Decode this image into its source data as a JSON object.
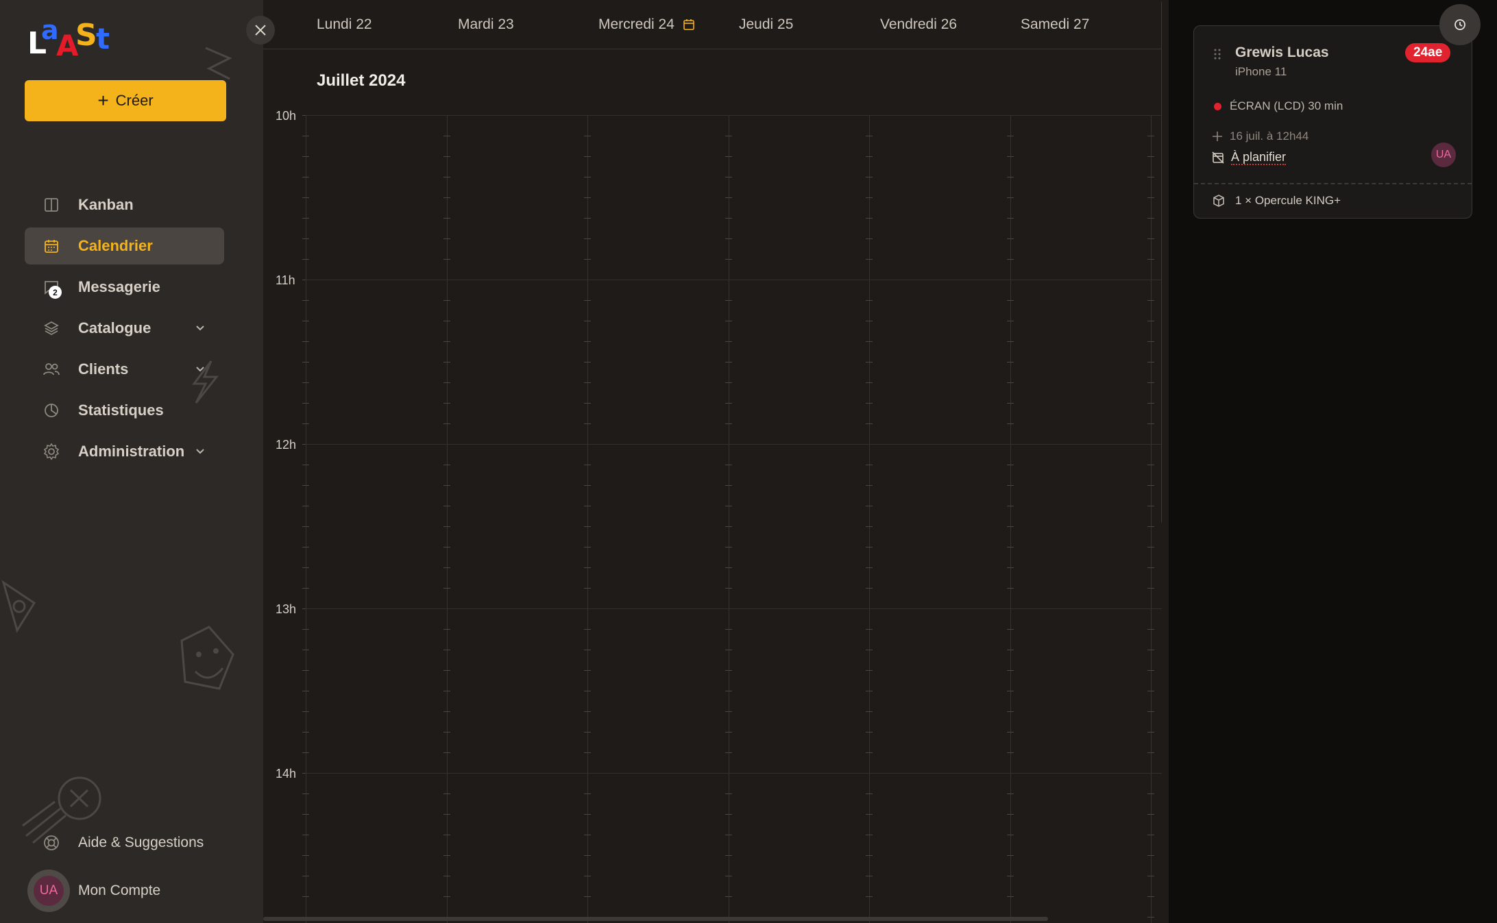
{
  "app": {
    "logo_text": "LaASt",
    "colors": {
      "accent": "#f4b31b",
      "badge_red": "#e1232f",
      "avatar_pink": "#ef6aa0"
    }
  },
  "sidebar": {
    "create_label": "Créer",
    "items": [
      {
        "label": "Kanban",
        "icon": "kanban-icon",
        "active": false,
        "expandable": false
      },
      {
        "label": "Calendrier",
        "icon": "calendar-icon",
        "active": true,
        "expandable": false
      },
      {
        "label": "Messagerie",
        "icon": "message-icon",
        "active": false,
        "expandable": false,
        "badge": "2"
      },
      {
        "label": "Catalogue",
        "icon": "layers-icon",
        "active": false,
        "expandable": true
      },
      {
        "label": "Clients",
        "icon": "users-icon",
        "active": false,
        "expandable": true
      },
      {
        "label": "Statistiques",
        "icon": "pie-chart-icon",
        "active": false,
        "expandable": false
      },
      {
        "label": "Administration",
        "icon": "gear-icon",
        "active": false,
        "expandable": true
      }
    ],
    "help_label": "Aide & Suggestions",
    "account_label": "Mon Compte",
    "account_initials": "UA"
  },
  "calendar": {
    "days": [
      "Lundi 22",
      "Mardi 23",
      "Mercredi 24",
      "Jeudi 25",
      "Vendredi 26",
      "Samedi 27"
    ],
    "today_index": 2,
    "month_title": "Juillet 2024",
    "hours": [
      "10h",
      "11h",
      "12h",
      "13h",
      "14h"
    ]
  },
  "card": {
    "customer": "Grewis Lucas",
    "device": "iPhone 11",
    "tag": "24ae",
    "repair": "ÉCRAN (LCD) 30 min",
    "created": "16 juil. à 12h44",
    "status": "À planifier",
    "assignee_initials": "UA",
    "product": "1 × Opercule KING+"
  }
}
